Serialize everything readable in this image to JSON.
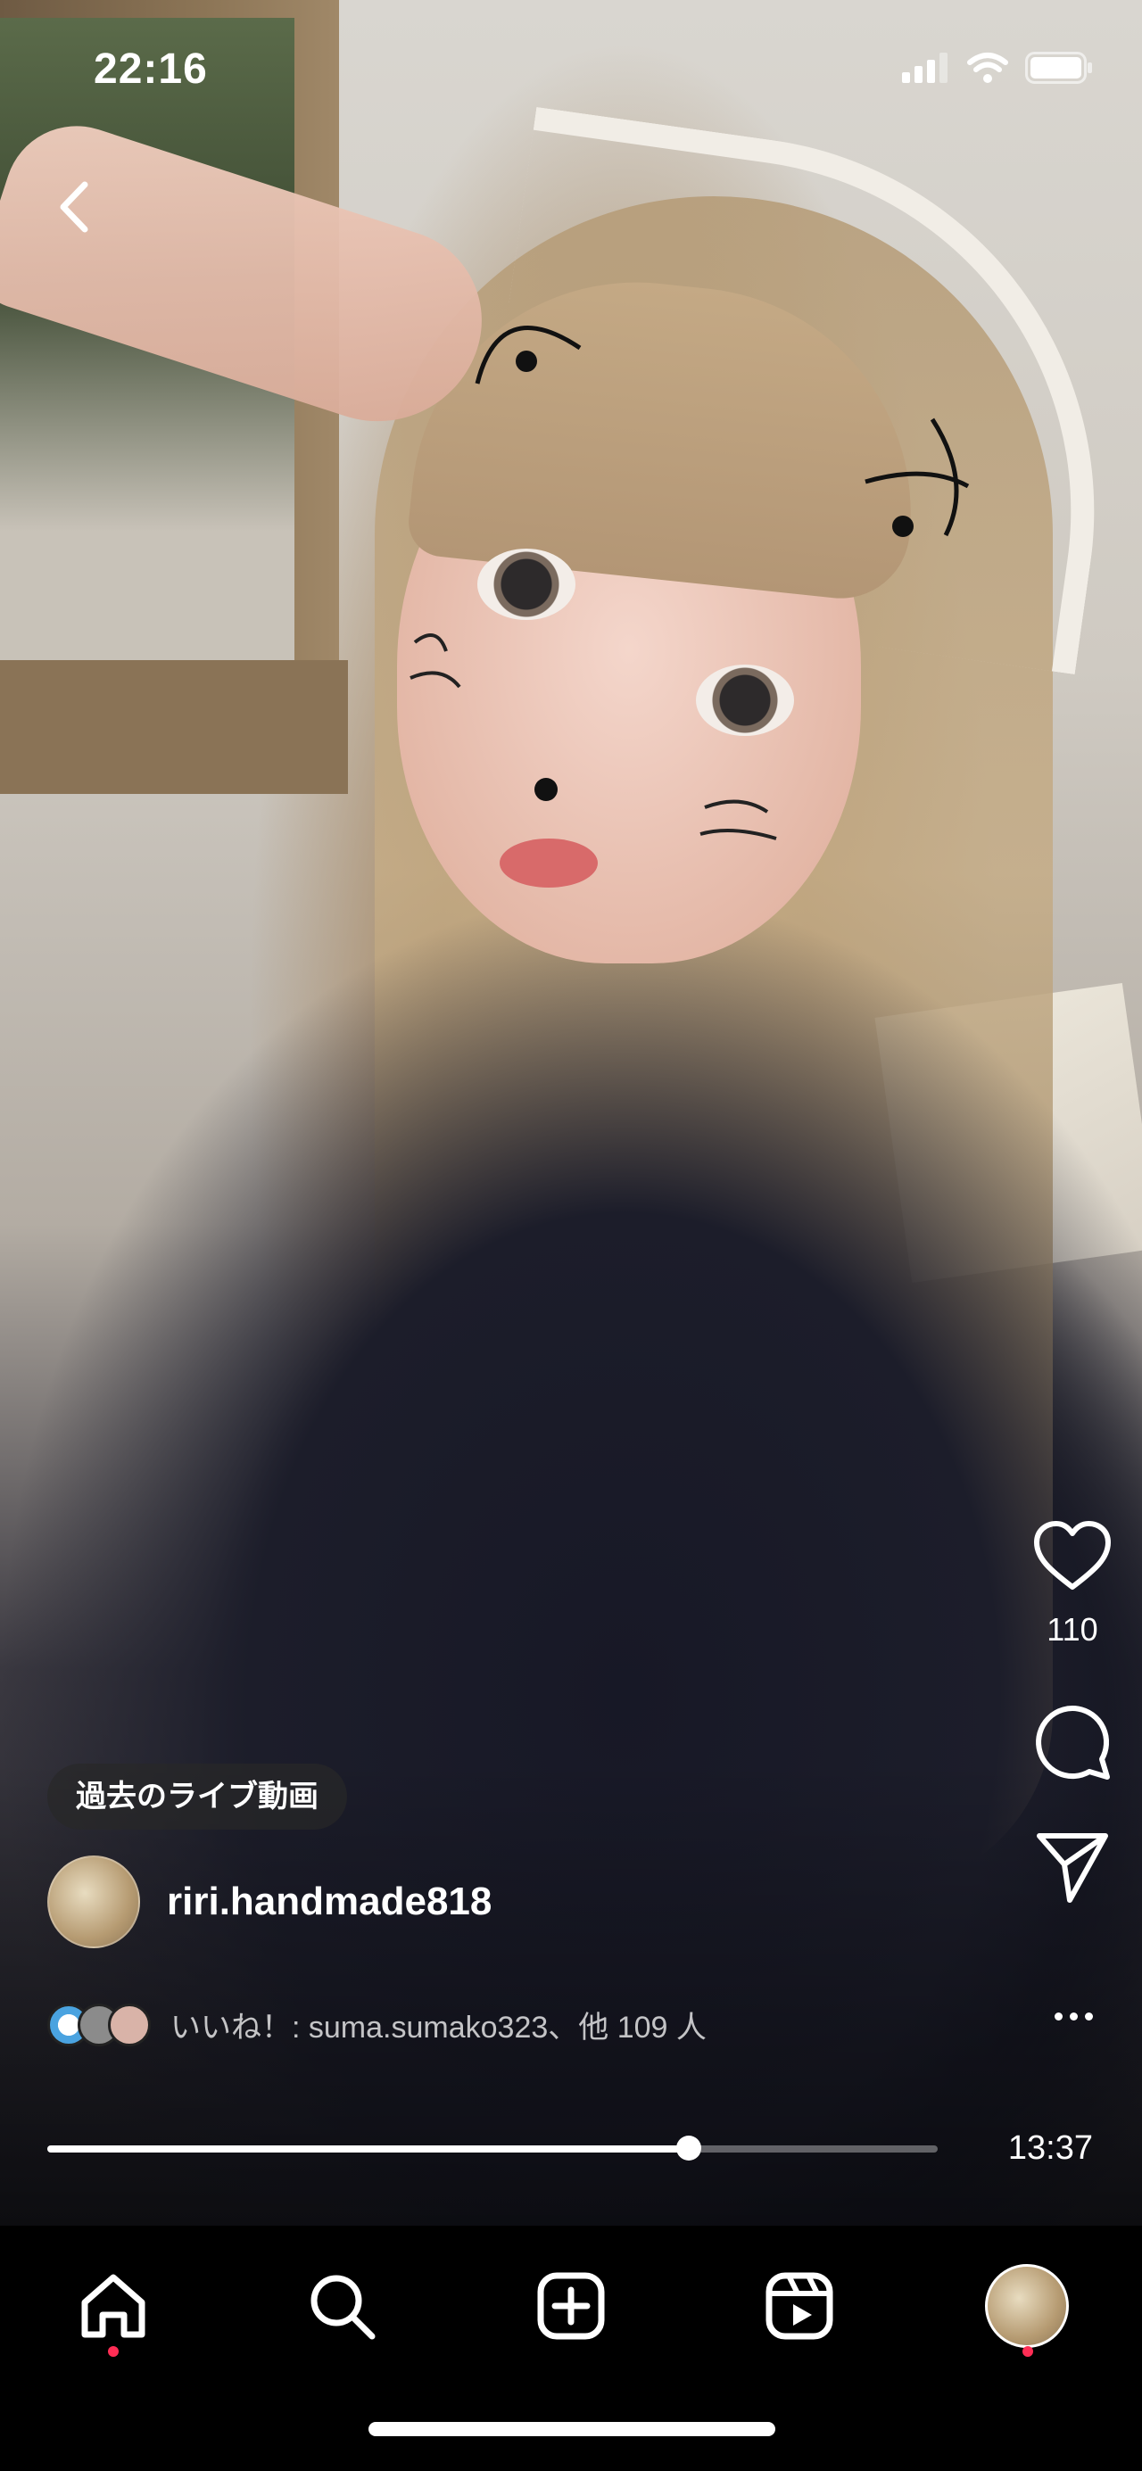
{
  "status_bar": {
    "time": "22:16"
  },
  "video": {
    "badge": "過去のライブ動画",
    "username": "riri.handmade818",
    "likes_text": "いいね！: suma.sumako323、他 109 人",
    "like_count": "110",
    "progress": 0.72,
    "duration": "13:37"
  },
  "icons": {
    "back": "chevron-left-icon",
    "like": "heart-icon",
    "comment": "comment-icon",
    "share": "send-icon",
    "more": "more-horizontal-icon"
  },
  "tabbar": {
    "items": [
      "home-icon",
      "search-icon",
      "create-icon",
      "reels-icon",
      "profile-avatar"
    ]
  },
  "colors": {
    "notification_dot": "#ff2d55"
  }
}
